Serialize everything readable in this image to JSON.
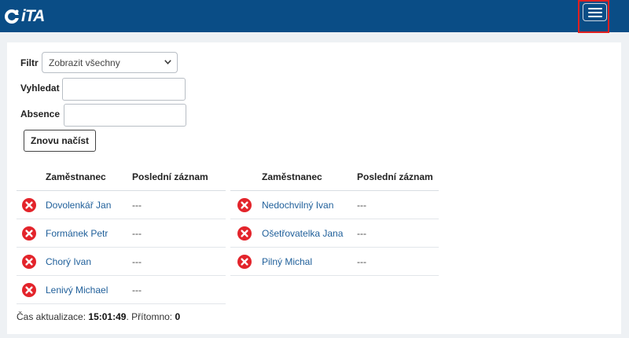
{
  "header": {
    "logo_text": "iTA",
    "menu_button_icon": "hamburger-menu-icon"
  },
  "filters": {
    "filter_label": "Filtr",
    "filter_value": "Zobrazit všechny",
    "search_label": "Vyhledat",
    "search_value": "",
    "absence_label": "Absence",
    "absence_value": "",
    "reload_label": "Znovu načíst"
  },
  "table_left": {
    "headers": [
      "Zaměstnanec",
      "Poslední záznam"
    ],
    "rows": [
      {
        "status_icon": "absent-x-icon",
        "name": "Dovolenkář Jan",
        "last_record": "---"
      },
      {
        "status_icon": "absent-x-icon",
        "name": "Formánek Petr",
        "last_record": "---"
      },
      {
        "status_icon": "absent-x-icon",
        "name": "Chorý Ivan",
        "last_record": "---"
      },
      {
        "status_icon": "absent-x-icon",
        "name": "Lenivý Michael",
        "last_record": "---"
      }
    ]
  },
  "table_right": {
    "headers": [
      "Zaměstnanec",
      "Poslední záznam"
    ],
    "rows": [
      {
        "status_icon": "absent-x-icon",
        "name": "Nedochvilný Ivan",
        "last_record": "---"
      },
      {
        "status_icon": "absent-x-icon",
        "name": "Ošetřovatelka Jana",
        "last_record": "---"
      },
      {
        "status_icon": "absent-x-icon",
        "name": "Pilný Michal",
        "last_record": "---"
      }
    ]
  },
  "footer": {
    "update_label": "Čas aktualizace:",
    "update_time": "15:01:49",
    "present_label": "Přítomno:",
    "present_count": "0"
  },
  "colors": {
    "header_bg": "#0a4d86",
    "link": "#1f5f9a",
    "absent_icon": "#e3242b",
    "highlight_border": "#e02020"
  }
}
